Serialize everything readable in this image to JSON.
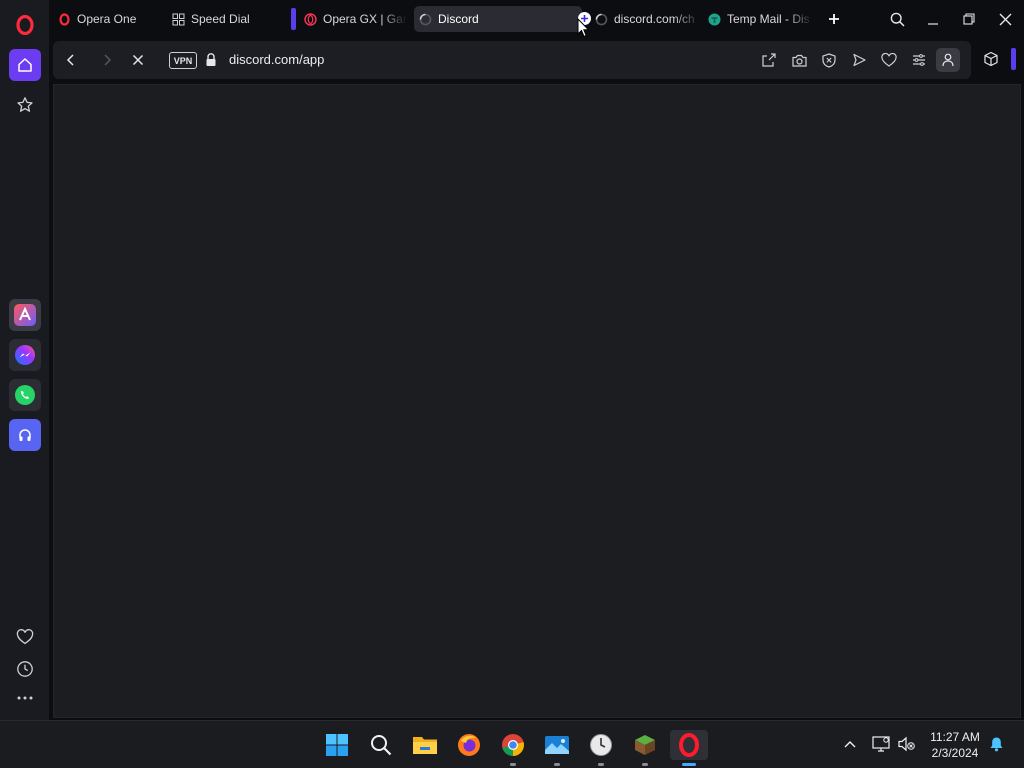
{
  "tabs": [
    {
      "label": "Opera One",
      "icon": "opera-icon"
    },
    {
      "label": "Speed Dial",
      "icon": "speed-dial-icon"
    },
    {
      "label": "Opera GX | Gam",
      "icon": "opera-gx-icon"
    },
    {
      "label": "Discord",
      "icon": "loading-spinner-icon",
      "active": true
    },
    {
      "label": "discord.com/ch",
      "icon": "loading-spinner-icon"
    },
    {
      "label": "Temp Mail - Dis",
      "icon": "temp-mail-icon"
    }
  ],
  "address_bar": {
    "vpn_label": "VPN",
    "url": "discord.com/app"
  },
  "taskbar": {
    "apps": [
      "start",
      "search",
      "file-explorer",
      "firefox",
      "chrome",
      "photos",
      "clock-app",
      "minecraft",
      "opera"
    ],
    "time": "11:27 AM",
    "date": "2/3/2024"
  },
  "colors": {
    "accent": "#6b3cf2",
    "background": "#0c0d10",
    "content": "#1c1d21"
  }
}
